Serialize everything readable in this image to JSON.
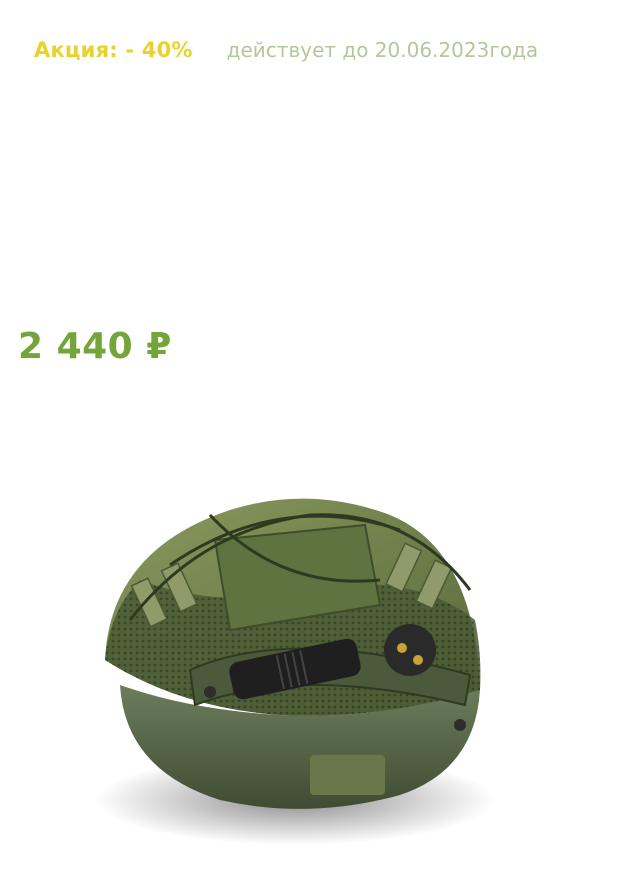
{
  "promo": {
    "label": "Акция: - 40%",
    "deadline": "действует до 20.06.2023года"
  },
  "product": {
    "price": "2 440 ₽",
    "image_icon": "tactical-helmet-image"
  },
  "colors": {
    "promo_label": "#e8d22c",
    "promo_deadline": "#b4c79a",
    "price": "#74a43a",
    "helmet_green": "#556b45"
  }
}
